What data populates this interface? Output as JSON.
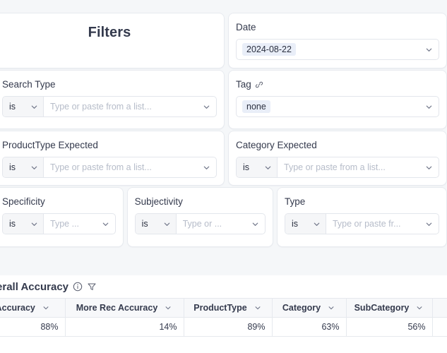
{
  "filters": {
    "title": "Filters",
    "rows": [
      {
        "left": {
          "kind": "title",
          "label": "Filters"
        },
        "right": {
          "kind": "single",
          "label": "Date",
          "value": "2024-08-22",
          "chevron": "chevron-down-icon"
        }
      },
      {
        "left": {
          "kind": "pair",
          "label": "Search Type",
          "operator": "is",
          "placeholder": "Type or paste from a list..."
        },
        "right": {
          "kind": "single",
          "label": "Tag",
          "label_icon": "link-icon",
          "value": "none",
          "chevron": "chevron-down-icon"
        }
      },
      {
        "left": {
          "kind": "pair",
          "label": "ProductType Expected",
          "operator": "is",
          "placeholder": "Type or paste from a list..."
        },
        "right": {
          "kind": "pair",
          "label": "Category Expected",
          "operator": "is",
          "placeholder": "Type or paste from a list..."
        }
      },
      {
        "a": {
          "kind": "pair",
          "label": "Specificity",
          "operator": "is",
          "placeholder": "Type ..."
        },
        "b": {
          "kind": "pair",
          "label": "Subjectivity",
          "operator": "is",
          "placeholder": "Type or ..."
        },
        "c": {
          "kind": "pair",
          "label": "Type",
          "operator": "is",
          "placeholder": "Type or paste fr..."
        }
      }
    ]
  },
  "results": {
    "title": "Overall Accuracy",
    "info_icon": "info-circle-icon",
    "filter_icon": "funnel-filter-icon",
    "columns": [
      {
        "label": "Accuracy",
        "sort": "chevron-down-icon"
      },
      {
        "label": "More Rec Accuracy",
        "sort": "chevron-down-icon"
      },
      {
        "label": "ProductType",
        "sort": "chevron-down-icon"
      },
      {
        "label": "Category",
        "sort": "chevron-down-icon"
      },
      {
        "label": "SubCategory",
        "sort": "chevron-down-icon"
      }
    ],
    "rows": [
      {
        "accuracy": "88%",
        "more_rec_accuracy": "14%",
        "product_type": "89%",
        "category": "63%",
        "sub_category": "56%"
      }
    ]
  },
  "colors": {
    "page_background": "#f5f7f9",
    "card_background": "#ffffff",
    "card_border": "#e7eaef",
    "pill_background": "#e9eef8",
    "text_primary": "#343a4d",
    "placeholder": "#b6bcc9",
    "table_header_background": "#f7f8fa"
  }
}
